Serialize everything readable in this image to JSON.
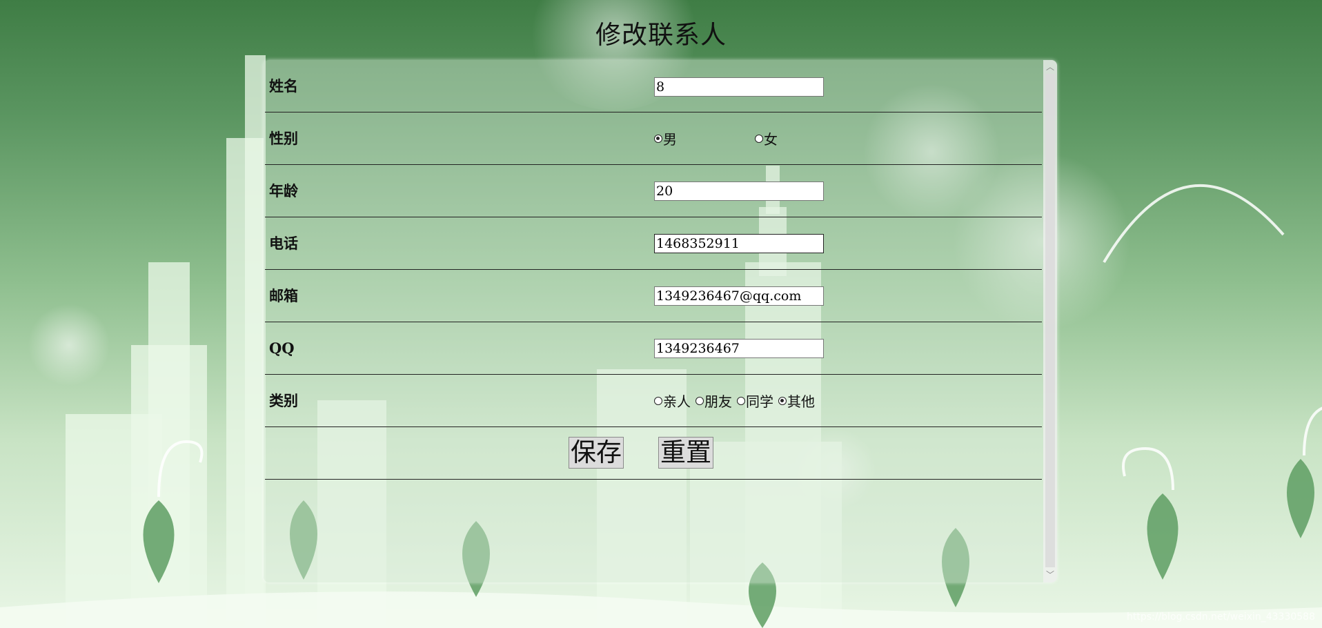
{
  "page": {
    "title": "修改联系人"
  },
  "form": {
    "name": {
      "label": "姓名",
      "value": "8"
    },
    "gender": {
      "label": "性别",
      "options": [
        {
          "label": "男",
          "selected": true
        },
        {
          "label": "女",
          "selected": false
        }
      ]
    },
    "age": {
      "label": "年龄",
      "value": "20"
    },
    "phone": {
      "label": "电话",
      "value": "1468352911"
    },
    "email": {
      "label": "邮箱",
      "value": "1349236467@qq.com"
    },
    "qq": {
      "label": "QQ",
      "value": "1349236467"
    },
    "category": {
      "label": "类别",
      "options": [
        {
          "label": "亲人",
          "selected": false
        },
        {
          "label": "朋友",
          "selected": false
        },
        {
          "label": "同学",
          "selected": false
        },
        {
          "label": "其他",
          "selected": true
        }
      ]
    }
  },
  "actions": {
    "save_label": "保存",
    "reset_label": "重置"
  },
  "watermark": "https://blog.csdn.net/weixin_43330588"
}
